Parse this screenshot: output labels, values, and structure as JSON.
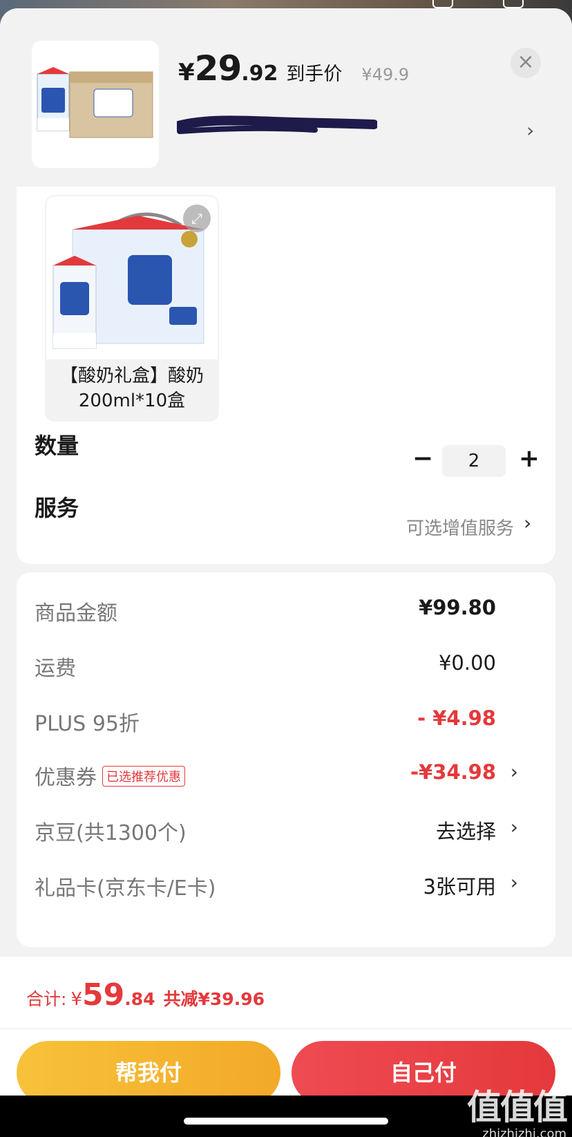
{
  "header": {
    "price_yen": "¥",
    "price_int": "29",
    "price_dec": ".92",
    "price_tag": "到手价",
    "original_price": "¥49.9",
    "close_symbol": "×",
    "chevron": "›"
  },
  "variant": {
    "label": "【酸奶礼盒】酸奶200ml*10盒",
    "expand_icon": "⤢"
  },
  "quantity": {
    "label": "数量",
    "minus": "−",
    "value": "2",
    "plus": "+"
  },
  "service": {
    "label": "服务",
    "hint": "可选增值服务",
    "chevron": "›"
  },
  "summary": {
    "goods_label": "商品金额",
    "goods_value": "¥99.80",
    "shipping_label": "运费",
    "shipping_value": "¥0.00",
    "plus_label": "PLUS 95折",
    "plus_value": "- ¥4.98",
    "coupon_label": "优惠券",
    "coupon_badge": "已选推荐优惠",
    "coupon_value": "-¥34.98",
    "beans_label": "京豆(共1300个)",
    "beans_value": "去选择",
    "giftcard_label": "礼品卡(京东卡/E卡)",
    "giftcard_value": "3张可用",
    "chevron": "›"
  },
  "footer": {
    "total_label": "合计:",
    "total_yen": "¥",
    "total_int": "59",
    "total_dec": ".84",
    "saved": "共减¥39.96",
    "help_pay": "帮我付",
    "self_pay": "自己付"
  },
  "watermark": {
    "big": "值值值",
    "small": "zhizhizhi.com"
  },
  "colors": {
    "accent_red": "#e4393c",
    "help_button": "#f3a928",
    "self_button": "#e4393c"
  }
}
